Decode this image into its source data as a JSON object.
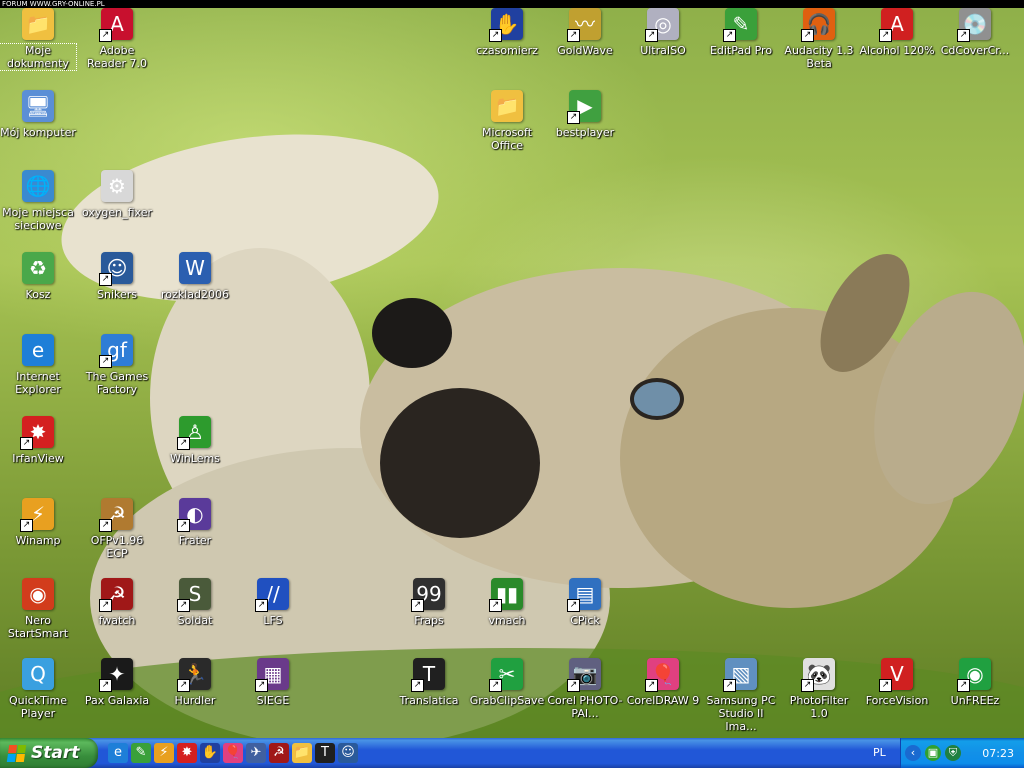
{
  "top_banner": "FORUM WWW.GRY-ONLINE.PL",
  "desktop_icons": [
    {
      "label": "Moje dokumenty",
      "icon": "my-documents-icon",
      "glyph": "📁",
      "color": "#f0c040",
      "shortcut": false
    },
    {
      "label": "Adobe Reader 7.0",
      "icon": "adobe-reader-icon",
      "glyph": "A",
      "color": "#c8102e",
      "shortcut": true
    },
    {
      "label": "Mój komputer",
      "icon": "my-computer-icon",
      "glyph": "🖥",
      "color": "#5b8fd6",
      "shortcut": false
    },
    {
      "label": "Moje miejsca sieciowe",
      "icon": "network-places-icon",
      "glyph": "🌐",
      "color": "#3a8ad0",
      "shortcut": false
    },
    {
      "label": "oxygen_fixer",
      "icon": "oxygen-fixer-icon",
      "glyph": "⚙",
      "color": "#d8d8d8",
      "shortcut": false
    },
    {
      "label": "Kosz",
      "icon": "recycle-bin-icon",
      "glyph": "♻",
      "color": "#4aa84a",
      "shortcut": false
    },
    {
      "label": "Snikers",
      "icon": "snikers-icon",
      "glyph": "☺",
      "color": "#2a5a9a",
      "shortcut": true
    },
    {
      "label": "rozklad2006",
      "icon": "word-document-icon",
      "glyph": "W",
      "color": "#2b5fb0",
      "shortcut": false
    },
    {
      "label": "Internet Explorer",
      "icon": "internet-explorer-icon",
      "glyph": "e",
      "color": "#1e7fd8",
      "shortcut": false
    },
    {
      "label": "The Games Factory",
      "icon": "games-factory-icon",
      "glyph": "gf",
      "color": "#2e7dd6",
      "shortcut": true
    },
    {
      "label": "IrfanView",
      "icon": "irfanview-icon",
      "glyph": "✸",
      "color": "#d42020",
      "shortcut": true
    },
    {
      "label": "WinLems",
      "icon": "winlems-icon",
      "glyph": "♙",
      "color": "#2d9b2d",
      "shortcut": true
    },
    {
      "label": "Winamp",
      "icon": "winamp-icon",
      "glyph": "⚡",
      "color": "#e8a020",
      "shortcut": true
    },
    {
      "label": "OFPv1.96 ECP",
      "icon": "ofp-ecp-icon",
      "glyph": "☭",
      "color": "#b07a30",
      "shortcut": true
    },
    {
      "label": "Frater",
      "icon": "frater-icon",
      "glyph": "◐",
      "color": "#5a3a9a",
      "shortcut": true
    },
    {
      "label": "Nero StartSmart",
      "icon": "nero-icon",
      "glyph": "◉",
      "color": "#d23c1c",
      "shortcut": false
    },
    {
      "label": "fwatch",
      "icon": "fwatch-icon",
      "glyph": "☭",
      "color": "#a01818",
      "shortcut": true
    },
    {
      "label": "Soldat",
      "icon": "soldat-icon",
      "glyph": "S",
      "color": "#4a5a3a",
      "shortcut": true
    },
    {
      "label": "LFS",
      "icon": "lfs-icon",
      "glyph": "//",
      "color": "#2050c0",
      "shortcut": true
    },
    {
      "label": "QuickTime Player",
      "icon": "quicktime-icon",
      "glyph": "Q",
      "color": "#3aa0e0",
      "shortcut": false
    },
    {
      "label": "Pax Galaxia",
      "icon": "pax-galaxia-icon",
      "glyph": "✦",
      "color": "#1a1a1a",
      "shortcut": true
    },
    {
      "label": "Hurdler",
      "icon": "hurdler-icon",
      "glyph": "🏃",
      "color": "#2a2a2a",
      "shortcut": true
    },
    {
      "label": "SIEGE",
      "icon": "siege-icon",
      "glyph": "▦",
      "color": "#6a3a8a",
      "shortcut": true
    },
    {
      "label": "czasomierz",
      "icon": "czasomierz-icon",
      "glyph": "✋",
      "color": "#2040a0",
      "shortcut": true
    },
    {
      "label": "GoldWave",
      "icon": "goldwave-icon",
      "glyph": "〰",
      "color": "#c0a030",
      "shortcut": true
    },
    {
      "label": "UltraISO",
      "icon": "ultraiso-icon",
      "glyph": "◎",
      "color": "#b0b0c0",
      "shortcut": true
    },
    {
      "label": "EditPad Pro",
      "icon": "editpad-icon",
      "glyph": "✎",
      "color": "#3aa03a",
      "shortcut": true
    },
    {
      "label": "Audacity 1.3 Beta",
      "icon": "audacity-icon",
      "glyph": "🎧",
      "color": "#e06010",
      "shortcut": true
    },
    {
      "label": "Alcohol 120%",
      "icon": "alcohol-icon",
      "glyph": "A",
      "color": "#d02020",
      "shortcut": true
    },
    {
      "label": "CdCoverCr...",
      "icon": "cdcover-icon",
      "glyph": "💿",
      "color": "#909090",
      "shortcut": true
    },
    {
      "label": "Microsoft Office",
      "icon": "folder-icon",
      "glyph": "📁",
      "color": "#f0c040",
      "shortcut": false
    },
    {
      "label": "bestplayer",
      "icon": "bestplayer-icon",
      "glyph": "▶",
      "color": "#40a040",
      "shortcut": true
    },
    {
      "label": "Fraps",
      "icon": "fraps-icon",
      "glyph": "99",
      "color": "#303030",
      "shortcut": true
    },
    {
      "label": "vmach",
      "icon": "vmach-icon",
      "glyph": "▮▮",
      "color": "#2a8a2a",
      "shortcut": true
    },
    {
      "label": "CPick",
      "icon": "cpick-icon",
      "glyph": "▤",
      "color": "#3070c0",
      "shortcut": true
    },
    {
      "label": "Translatica",
      "icon": "translatica-icon",
      "glyph": "T",
      "color": "#202020",
      "shortcut": true
    },
    {
      "label": "GrabClipSave",
      "icon": "grabclipsave-icon",
      "glyph": "✂",
      "color": "#20a040",
      "shortcut": true
    },
    {
      "label": "Corel PHOTO-PAI...",
      "icon": "corel-photopaint-icon",
      "glyph": "📷",
      "color": "#606080",
      "shortcut": true
    },
    {
      "label": "CorelDRAW 9",
      "icon": "coreldraw-icon",
      "glyph": "🎈",
      "color": "#e04080",
      "shortcut": true
    },
    {
      "label": "Samsung PC Studio II Ima...",
      "icon": "samsung-pc-studio-icon",
      "glyph": "▧",
      "color": "#6090c0",
      "shortcut": true
    },
    {
      "label": "PhotoFilter 1.0",
      "icon": "photofilter-icon",
      "glyph": "🐼",
      "color": "#e0e0e0",
      "shortcut": true
    },
    {
      "label": "ForceVision",
      "icon": "forcevision-icon",
      "glyph": "V",
      "color": "#d02020",
      "shortcut": true
    },
    {
      "label": "UnFREEz",
      "icon": "unfreez-icon",
      "glyph": "◉",
      "color": "#20a040",
      "shortcut": true
    }
  ],
  "taskbar": {
    "start_label": "Start",
    "quick_launch": [
      {
        "icon": "ie-quicklaunch-icon",
        "glyph": "e",
        "color": "#1e7fd8"
      },
      {
        "icon": "editpad-quicklaunch-icon",
        "glyph": "✎",
        "color": "#3aa03a"
      },
      {
        "icon": "winamp-quicklaunch-icon",
        "glyph": "⚡",
        "color": "#e8a020"
      },
      {
        "icon": "irfanview-quicklaunch-icon",
        "glyph": "✸",
        "color": "#d42020"
      },
      {
        "icon": "czasomierz-quicklaunch-icon",
        "glyph": "✋",
        "color": "#2040a0"
      },
      {
        "icon": "coreldraw-quicklaunch-icon",
        "glyph": "🎈",
        "color": "#e04080"
      },
      {
        "icon": "plane-quicklaunch-icon",
        "glyph": "✈",
        "color": "#4060a0"
      },
      {
        "icon": "fwatch-quicklaunch-icon",
        "glyph": "☭",
        "color": "#a01818"
      },
      {
        "icon": "folder-quicklaunch-icon",
        "glyph": "📁",
        "color": "#f0c040"
      },
      {
        "icon": "translatica-quicklaunch-icon",
        "glyph": "T",
        "color": "#202020"
      },
      {
        "icon": "snikers-quicklaunch-icon",
        "glyph": "☺",
        "color": "#2a5a9a"
      }
    ],
    "tray": {
      "language": "PL",
      "clock": "07:23",
      "icons": [
        {
          "icon": "tray-chevron-icon",
          "glyph": "‹",
          "color": "#1a6ad0"
        },
        {
          "icon": "tray-network-icon",
          "glyph": "▣",
          "color": "#30a030"
        },
        {
          "icon": "tray-security-icon",
          "glyph": "⛨",
          "color": "#208040"
        }
      ]
    }
  }
}
